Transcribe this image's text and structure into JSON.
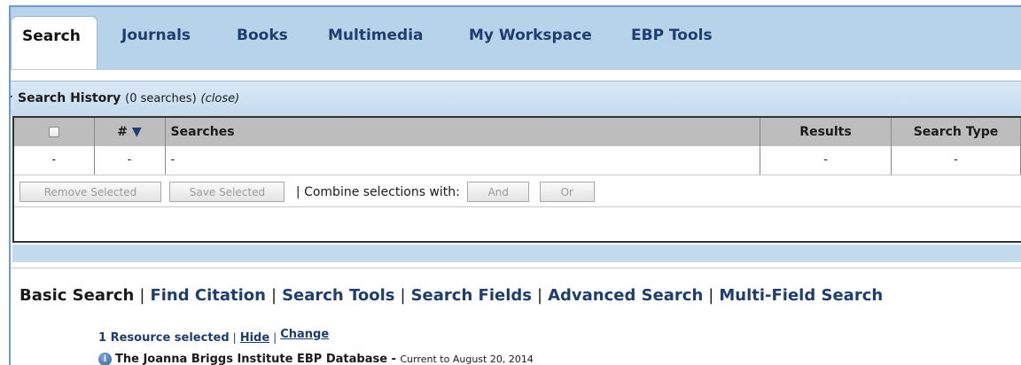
{
  "tabs": [
    {
      "label": "Search",
      "active": true
    },
    {
      "label": "Journals"
    },
    {
      "label": "Books"
    },
    {
      "label": "Multimedia"
    },
    {
      "label": "My Workspace"
    },
    {
      "label": "EBP Tools"
    }
  ],
  "history": {
    "title": "Search History",
    "count": "(0 searches)",
    "close": "(close)",
    "columns": {
      "num": "#",
      "sort_arrow": "▼",
      "searches": "Searches",
      "results": "Results",
      "search_type": "Search Type"
    },
    "row": {
      "chk": "-",
      "num": "-",
      "searches": "-",
      "results": "-",
      "search_type": "-"
    },
    "remove_label": "Remove Selected",
    "save_label": "Save Selected",
    "combine_label": "| Combine selections with:",
    "and_label": "And",
    "or_label": "Or"
  },
  "modes": [
    "Basic Search",
    "Find Citation",
    "Search Tools",
    "Search Fields",
    "Advanced Search",
    "Multi-Field Search"
  ],
  "resource": {
    "selected": "1 Resource selected",
    "pipe": "|",
    "hide": "Hide",
    "change": "Change"
  },
  "database": {
    "icon": "info-icon",
    "name": "The Joanna Briggs Institute EBP Database -",
    "current": "Current to August 20, 2014"
  },
  "colors": {
    "tab_bar": "#b7d3ea",
    "link": "#1d3e6e",
    "header_gray": "#bdbdbd"
  }
}
